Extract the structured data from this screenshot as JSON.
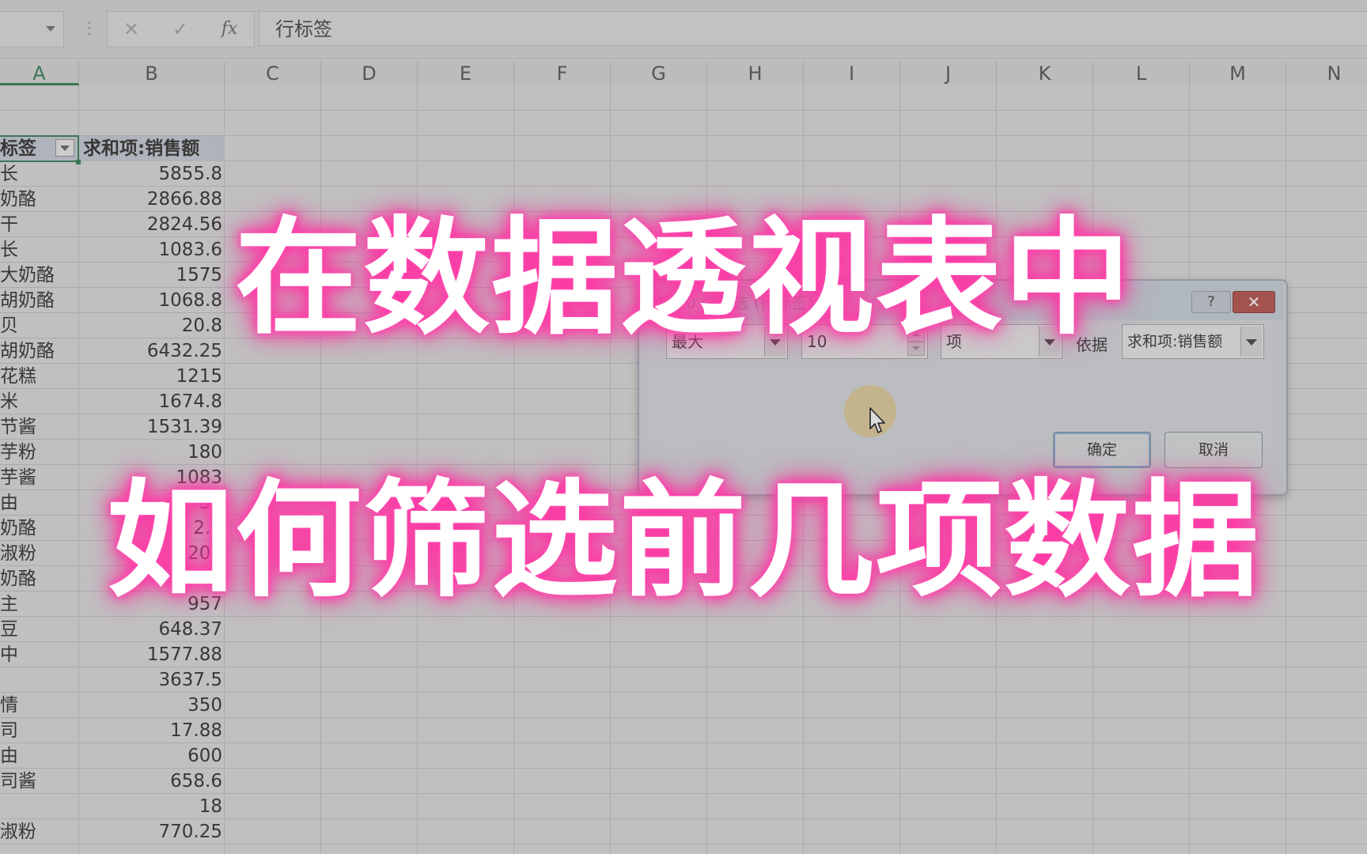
{
  "formula_bar": {
    "cancel_glyph": "✕",
    "enter_glyph": "✓",
    "fx_label": "fx",
    "formula_text": "行标签",
    "name_box_value": ""
  },
  "columns": [
    "A",
    "B",
    "C",
    "D",
    "E",
    "F",
    "G",
    "H",
    "I",
    "J",
    "K",
    "L",
    "M",
    "N"
  ],
  "pivot": {
    "header_label": "标签",
    "header_value": "求和项:销售额",
    "rows": [
      {
        "label": "长",
        "value": "5855.8"
      },
      {
        "label": "奶酪",
        "value": "2866.88"
      },
      {
        "label": "干",
        "value": "2824.56"
      },
      {
        "label": "长",
        "value": "1083.6"
      },
      {
        "label": "大奶酪",
        "value": "1575"
      },
      {
        "label": "胡奶酪",
        "value": "1068.8"
      },
      {
        "label": "贝",
        "value": "20.8"
      },
      {
        "label": "胡奶酪",
        "value": "6432.25"
      },
      {
        "label": "花糕",
        "value": "1215"
      },
      {
        "label": "米",
        "value": "1674.8"
      },
      {
        "label": "节酱",
        "value": "1531.39"
      },
      {
        "label": "芋粉",
        "value": "180"
      },
      {
        "label": "芋酱",
        "value": "1083"
      },
      {
        "label": "由",
        "value": "33"
      },
      {
        "label": "奶酪",
        "value": "2.2"
      },
      {
        "label": "淑粉",
        "value": "200"
      },
      {
        "label": "奶酪",
        "value": "0.48"
      },
      {
        "label": "主",
        "value": "957"
      },
      {
        "label": "豆",
        "value": "648.37"
      },
      {
        "label": "中",
        "value": "1577.88"
      },
      {
        "label": "",
        "value": "3637.5"
      },
      {
        "label": "情",
        "value": "350"
      },
      {
        "label": "司",
        "value": "17.88"
      },
      {
        "label": "由",
        "value": "600"
      },
      {
        "label": "司酱",
        "value": "658.6"
      },
      {
        "label": "",
        "value": "18"
      },
      {
        "label": "淑粉",
        "value": "770.25"
      }
    ]
  },
  "dialog": {
    "title": "前 10 个筛选 (行标签)",
    "help": "?",
    "close": "✕",
    "direction": "最大",
    "count": "10",
    "unit": "项",
    "basis_label": "依据",
    "basis_field": "求和项:销售额",
    "ok": "确定",
    "cancel": "取消"
  },
  "overlay": {
    "line1": "在数据透视表中",
    "line2": "如何筛选前几项数据"
  }
}
